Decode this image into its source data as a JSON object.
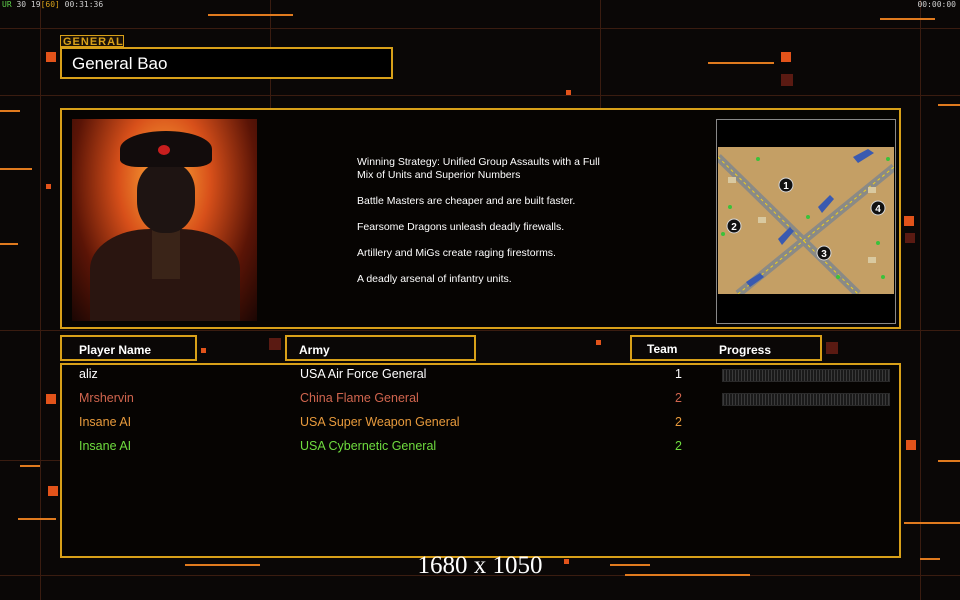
{
  "hud": {
    "left_prefix": "UR",
    "left_values": "30 19",
    "left_bracket": "[60]",
    "left_time": "00:31:36",
    "right_time": "00:00:00"
  },
  "general": {
    "tag": "GENERAL",
    "name": "General Bao"
  },
  "strategy": {
    "lines": [
      "Winning Strategy: Unified Group Assaults with a Full\n Mix of Units and Superior Numbers",
      "Battle Masters are cheaper and are built faster.",
      "Fearsome Dragons unleash deadly firewalls.",
      "Artillery and MiGs create raging firestorms.",
      "A deadly arsenal of infantry units."
    ]
  },
  "map": {
    "icon": "minimap-image",
    "start_positions": [
      "1",
      "2",
      "3",
      "4"
    ]
  },
  "table": {
    "headers": {
      "player": "Player Name",
      "army": "Army",
      "team": "Team",
      "progress": "Progress"
    },
    "rows": [
      {
        "name": "aliz",
        "army": "USA Air Force General",
        "team": "1",
        "color": "#ffffff",
        "progress": 0
      },
      {
        "name": "Mrshervin",
        "army": "China Flame General",
        "team": "2",
        "color": "#d0654e",
        "progress": 0
      },
      {
        "name": "Insane AI",
        "army": "USA Super Weapon General",
        "team": "2",
        "color": "#e79a3c"
      },
      {
        "name": "Insane AI",
        "army": "USA Cybernetic General",
        "team": "2",
        "color": "#6fdc3f"
      }
    ]
  },
  "resolution": "1680 x 1050",
  "colors": {
    "accent": "#d8a019",
    "background": "#0a0706"
  }
}
